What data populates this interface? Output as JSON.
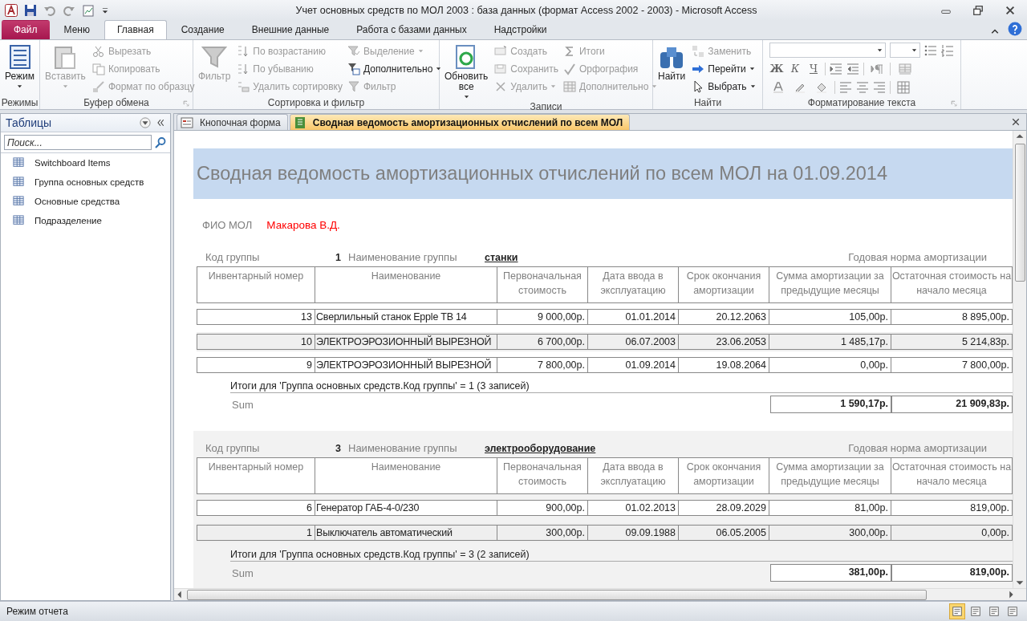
{
  "window": {
    "title": "Учет основных средств по МОЛ 2003 : база данных (формат Access 2002 - 2003)  -  Microsoft Access"
  },
  "ribbon_tabs": [
    {
      "label": "Файл",
      "kind": "file",
      "selected": false
    },
    {
      "label": "Меню",
      "kind": "tab",
      "selected": false
    },
    {
      "label": "Главная",
      "kind": "tab",
      "selected": true
    },
    {
      "label": "Создание",
      "kind": "tab",
      "selected": false
    },
    {
      "label": "Внешние данные",
      "kind": "tab",
      "selected": false
    },
    {
      "label": "Работа с базами данных",
      "kind": "tab",
      "selected": false
    },
    {
      "label": "Надстройки",
      "kind": "tab",
      "selected": false
    }
  ],
  "ribbon_groups": [
    {
      "label": "Режимы",
      "launcher": false,
      "items": [
        {
          "label": "Режим",
          "kind": "large",
          "disabled": false,
          "dropdown": true
        }
      ]
    },
    {
      "label": "Буфер обмена",
      "launcher": true,
      "items": [
        {
          "label": "Вставить",
          "kind": "large",
          "disabled": true,
          "dropdown": true
        },
        {
          "label": "Вырезать",
          "kind": "small",
          "disabled": true,
          "dropdown": false
        },
        {
          "label": "Копировать",
          "kind": "small",
          "disabled": true,
          "dropdown": false
        },
        {
          "label": "Формат по образцу",
          "kind": "small",
          "disabled": true,
          "dropdown": false
        }
      ]
    },
    {
      "label": "Сортировка и фильтр",
      "launcher": false,
      "items": [
        {
          "label": "Фильтр",
          "kind": "large",
          "disabled": true,
          "dropdown": false
        },
        {
          "label": "По возрастанию",
          "kind": "small",
          "disabled": true,
          "dropdown": false
        },
        {
          "label": "По убыванию",
          "kind": "small",
          "disabled": true,
          "dropdown": false
        },
        {
          "label": "Удалить сортировку",
          "kind": "small",
          "disabled": true,
          "dropdown": false
        },
        {
          "label": "Выделение",
          "kind": "small",
          "disabled": true,
          "dropdown": true
        },
        {
          "label": "Дополнительно",
          "kind": "small",
          "disabled": false,
          "dropdown": true
        },
        {
          "label": "Фильтр",
          "kind": "small",
          "disabled": true,
          "dropdown": false
        }
      ]
    },
    {
      "label": "Записи",
      "launcher": false,
      "items": [
        {
          "label": "Обновить все",
          "kind": "large",
          "disabled": false,
          "dropdown": true
        },
        {
          "label": "Создать",
          "kind": "small",
          "disabled": true,
          "dropdown": false
        },
        {
          "label": "Сохранить",
          "kind": "small",
          "disabled": true,
          "dropdown": false
        },
        {
          "label": "Удалить",
          "kind": "small",
          "disabled": true,
          "dropdown": true
        },
        {
          "label": "Итоги",
          "kind": "small",
          "disabled": true,
          "dropdown": false
        },
        {
          "label": "Орфография",
          "kind": "small",
          "disabled": true,
          "dropdown": false
        },
        {
          "label": "Дополнительно",
          "kind": "small",
          "disabled": true,
          "dropdown": true
        }
      ]
    },
    {
      "label": "Найти",
      "launcher": false,
      "items": [
        {
          "label": "Найти",
          "kind": "large",
          "disabled": false,
          "dropdown": false
        },
        {
          "label": "Заменить",
          "kind": "small",
          "disabled": true,
          "dropdown": false
        },
        {
          "label": "Перейти",
          "kind": "small",
          "disabled": false,
          "dropdown": true
        },
        {
          "label": "Выбрать",
          "kind": "small",
          "disabled": false,
          "dropdown": true
        }
      ]
    }
  ],
  "format_group": {
    "label": "Форматирование текста",
    "launcher": true,
    "buttons": [
      {
        "label": "Ж"
      },
      {
        "label": "К"
      },
      {
        "label": "Ч"
      }
    ]
  },
  "nav_pane": {
    "title": "Таблицы",
    "search": {
      "placeholder": "Поиск..."
    },
    "items": [
      {
        "label": "Switchboard Items"
      },
      {
        "label": "Группа основных средств"
      },
      {
        "label": "Основные средства"
      },
      {
        "label": "Подразделение"
      }
    ]
  },
  "doc_tabs": [
    {
      "label": "Кнопочная форма",
      "kind": "form",
      "selected": false
    },
    {
      "label": "Сводная ведомость амортизационных отчислений по всем МОЛ",
      "kind": "report",
      "selected": true
    }
  ],
  "report": {
    "title": "Сводная ведомость амортизационных отчислений по всем МОЛ на  01.09.2014",
    "mol_label": "ФИО МОЛ",
    "mol_name": "Макарова В.Д.",
    "groups": [
      {
        "code_label": "Код группы",
        "code": "1",
        "name_label": "Наименование группы",
        "name": "станки",
        "rate_label": "Годовая норма амортизации",
        "columns": [
          "Инвентарный номер",
          "Наименование",
          "Первоначальная стоимость",
          "Дата ввода в эксплуатацию",
          "Срок окончания амортизации",
          "Сумма амортизации за предыдущие месяцы",
          "Остаточная стоимость на начало месяца"
        ],
        "rows": [
          [
            "13",
            "Сверлильный станок Epple TB 14",
            "9 000,00р.",
            "01.01.2014",
            "20.12.2063",
            "105,00р.",
            "8 895,00р."
          ],
          [
            "10",
            "ЭЛЕКТРОЭРОЗИОННЫЙ ВЫРЕЗНОЙ",
            "6 700,00р.",
            "06.07.2003",
            "23.06.2053",
            "1 485,17р.",
            "5 214,83р."
          ],
          [
            "9",
            "ЭЛЕКТРОЭРОЗИОННЫЙ ВЫРЕЗНОЙ",
            "7 800,00р.",
            "01.09.2014",
            "19.08.2064",
            "0,00р.",
            "7 800,00р."
          ]
        ],
        "summary": "Итоги для 'Группа основных средств.Код группы' =  1 (3 записей)",
        "sum_label": "Sum",
        "sums": [
          "1 590,17р.",
          "21 909,83р."
        ]
      },
      {
        "code_label": "Код группы",
        "code": "3",
        "name_label": "Наименование группы",
        "name": "электрооборудование",
        "rate_label": "Годовая норма амортизации",
        "columns": [
          "Инвентарный номер",
          "Наименование",
          "Первоначальная стоимость",
          "Дата ввода в эксплуатацию",
          "Срок окончания амортизации",
          "Сумма амортизации за предыдущие месяцы",
          "Остаточная стоимость на начало месяца"
        ],
        "rows": [
          [
            "6",
            "Генератор ГАБ-4-0/230",
            "900,00р.",
            "01.02.2013",
            "28.09.2029",
            "81,00р.",
            "819,00р."
          ],
          [
            "1",
            "Выключатель автоматический",
            "300,00р.",
            "09.09.1988",
            "06.05.2005",
            "300,00р.",
            "0,00р."
          ]
        ],
        "summary": "Итоги для 'Группа основных средств.Код группы' =  3 (2 записей)",
        "sum_label": "Sum",
        "sums": [
          "381,00р.",
          "819,00р."
        ]
      }
    ]
  },
  "status_bar": {
    "text": "Режим отчета",
    "views": [
      {
        "selected": true
      },
      {
        "selected": false
      },
      {
        "selected": false
      },
      {
        "selected": false
      }
    ]
  }
}
